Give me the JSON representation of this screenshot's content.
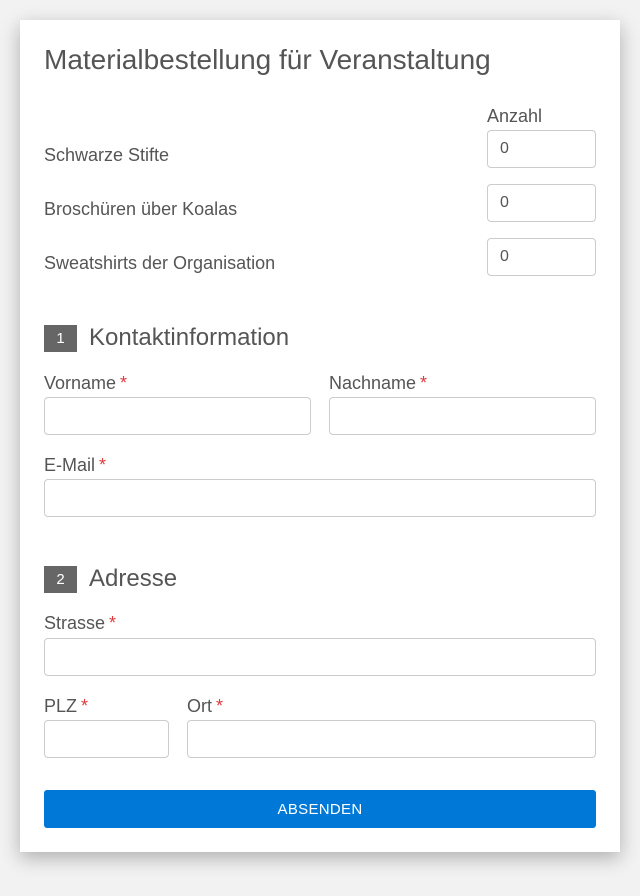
{
  "form": {
    "title": "Materialbestellung für Veranstaltung",
    "quantity_header": "Anzahl",
    "items": [
      {
        "label": "Schwarze Stifte",
        "quantity": "0"
      },
      {
        "label": "Broschüren über Koalas",
        "quantity": "0"
      },
      {
        "label": "Sweatshirts der Organisation",
        "quantity": "0"
      }
    ]
  },
  "contact": {
    "number": "1",
    "title": "Kontaktinformation",
    "first_name": {
      "label": "Vorname",
      "value": ""
    },
    "last_name": {
      "label": "Nachname",
      "value": ""
    },
    "email": {
      "label": "E-Mail",
      "value": ""
    }
  },
  "address": {
    "number": "2",
    "title": "Adresse",
    "street": {
      "label": "Strasse",
      "value": ""
    },
    "zip": {
      "label": "PLZ",
      "value": ""
    },
    "city": {
      "label": "Ort",
      "value": ""
    }
  },
  "required_marker": "*",
  "submit_label": "ABSENDEN",
  "colors": {
    "accent": "#0078d7",
    "required": "#e0393e",
    "section_badge": "#666666",
    "text": "#555555",
    "background": "#f2f2f2"
  }
}
